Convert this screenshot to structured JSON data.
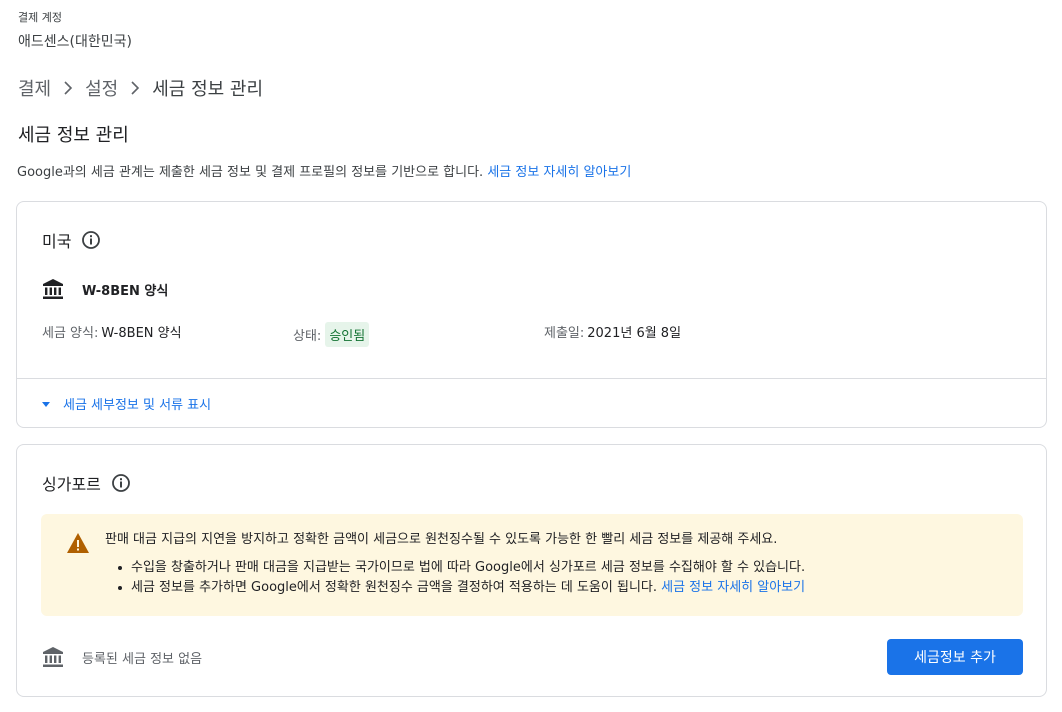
{
  "account": {
    "label": "결제 계정",
    "name": "애드센스(대한민국)"
  },
  "breadcrumb": {
    "items": [
      "결제",
      "설정",
      "세금 정보 관리"
    ]
  },
  "page": {
    "title": "세금 정보 관리",
    "intro": "Google과의 세금 관계는 제출한 세금 정보 및 결제 프로필의 정보를 기반으로 합니다. ",
    "intro_link": "세금 정보 자세히 알아보기"
  },
  "us_card": {
    "country": "미국",
    "form_name": "W-8BEN 양식",
    "tax_form_label": "세금 양식:",
    "tax_form_value": "W-8BEN 양식",
    "status_label": "상태:",
    "status_value": "승인됨",
    "submitted_label": "제출일:",
    "submitted_value": "2021년 6월 8일",
    "expander_label": "세금 세부정보 및 서류 표시"
  },
  "sg_card": {
    "country": "싱가포르",
    "warning_main": "판매 대금 지급의 지연을 방지하고 정확한 금액이 세금으로 원천징수될 수 있도록 가능한 한 빨리 세금 정보를 제공해 주세요.",
    "warning_bullet1": "수입을 창출하거나 판매 대금을 지급받는 국가이므로 법에 따라 Google에서 싱가포르 세금 정보를 수집해야 할 수 있습니다.",
    "warning_bullet2": "세금 정보를 추가하면 Google에서 정확한 원천징수 금액을 결정하여 적용하는 데 도움이 됩니다. ",
    "warning_link": "세금 정보 자세히 알아보기",
    "no_info": "등록된 세금 정보 없음",
    "add_button": "세금정보 추가"
  },
  "colors": {
    "link": "#1a73e8",
    "primary_button": "#1a73e8",
    "approved_badge_bg": "#e6f4ea",
    "approved_badge_text": "#137333",
    "warning_bg": "#fef7e0",
    "warning_icon": "#b06000"
  },
  "icons": {
    "info": "info-icon",
    "bank": "bank-icon",
    "warning": "warning-icon",
    "caret": "caret-down-icon",
    "chevron": "chevron-right-icon"
  }
}
